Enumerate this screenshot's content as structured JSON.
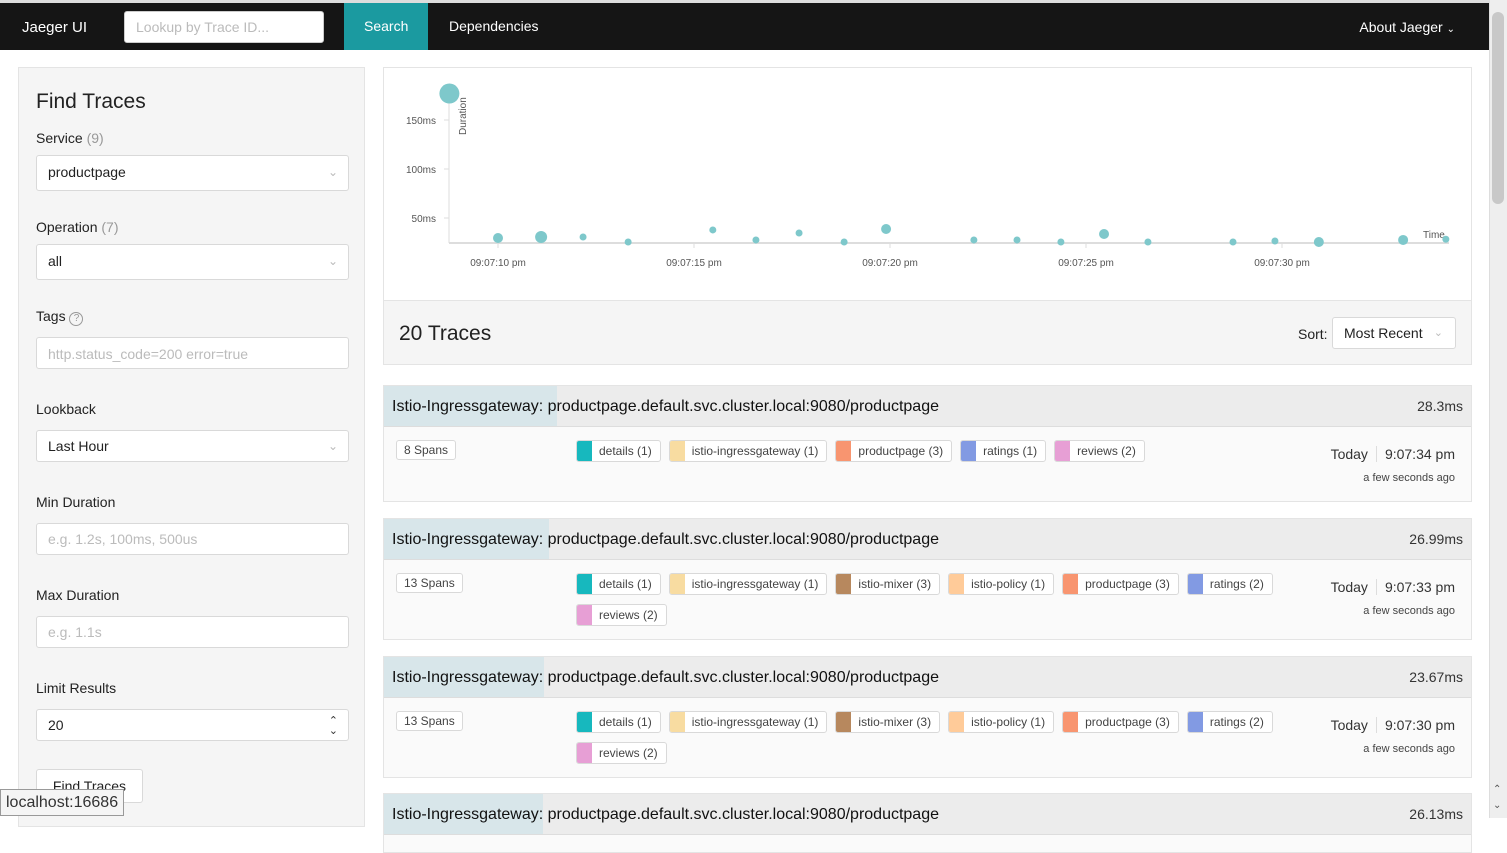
{
  "nav": {
    "brand": "Jaeger UI",
    "lookup_placeholder": "Lookup by Trace ID...",
    "search": "Search",
    "dependencies": "Dependencies",
    "about": "About Jaeger"
  },
  "form": {
    "title": "Find Traces",
    "service_label": "Service",
    "service_count": "(9)",
    "service_value": "productpage",
    "operation_label": "Operation",
    "operation_count": "(7)",
    "operation_value": "all",
    "tags_label": "Tags",
    "tags_placeholder": "http.status_code=200 error=true",
    "lookback_label": "Lookback",
    "lookback_value": "Last Hour",
    "min_label": "Min Duration",
    "min_placeholder": "e.g. 1.2s, 100ms, 500us",
    "max_label": "Max Duration",
    "max_placeholder": "e.g. 1.1s",
    "limit_label": "Limit Results",
    "limit_value": "20",
    "find_button": "Find Traces"
  },
  "status_url": "localhost:16686",
  "chart_data": {
    "type": "scatter",
    "ylabel": "Duration",
    "xlabel": "Time",
    "y_ticks": [
      "50ms",
      "100ms",
      "150ms"
    ],
    "y_tick_values": [
      50,
      100,
      150
    ],
    "x_ticks": [
      "09:07:10 pm",
      "09:07:15 pm",
      "09:07:20 pm",
      "09:07:25 pm",
      "09:07:30 pm"
    ],
    "x_tick_values": [
      10,
      15,
      20,
      25,
      30
    ],
    "xlim": [
      8.5,
      34.5
    ],
    "ylim": [
      25,
      180
    ],
    "color": "#7ec8cb",
    "points": [
      {
        "t": 8.76,
        "ms": 177,
        "spans": 30
      },
      {
        "t": 10.0,
        "ms": 29.6,
        "spans": 13
      },
      {
        "t": 11.1,
        "ms": 30.6,
        "spans": 16
      },
      {
        "t": 12.17,
        "ms": 30.6,
        "spans": 8
      },
      {
        "t": 13.32,
        "ms": 25,
        "spans": 8
      },
      {
        "t": 15.48,
        "ms": 37.8,
        "spans": 8
      },
      {
        "t": 16.58,
        "ms": 27.6,
        "spans": 8
      },
      {
        "t": 17.68,
        "ms": 34.7,
        "spans": 8
      },
      {
        "t": 18.83,
        "ms": 25,
        "spans": 8
      },
      {
        "t": 19.9,
        "ms": 38.8,
        "spans": 13
      },
      {
        "t": 22.14,
        "ms": 27.6,
        "spans": 8
      },
      {
        "t": 23.24,
        "ms": 27.6,
        "spans": 8
      },
      {
        "t": 24.36,
        "ms": 25.5,
        "spans": 8
      },
      {
        "t": 25.46,
        "ms": 33.7,
        "spans": 13
      },
      {
        "t": 26.58,
        "ms": 25,
        "spans": 8
      },
      {
        "t": 28.75,
        "ms": 25.5,
        "spans": 8
      },
      {
        "t": 29.82,
        "ms": 26.5,
        "spans": 8
      },
      {
        "t": 30.94,
        "ms": 25,
        "spans": 13
      },
      {
        "t": 33.09,
        "ms": 27.6,
        "spans": 13
      },
      {
        "t": 34.18,
        "ms": 28.3,
        "spans": 8
      }
    ]
  },
  "results": {
    "title": "20 Traces",
    "sort_label": "Sort:",
    "sort_value": "Most Recent"
  },
  "colors": {
    "details": "#17b8be",
    "istio-ingressgateway": "#f8dca1",
    "istio-mixer": "#b7885e",
    "istio-policy": "#ffcb99",
    "productpage": "#f89570",
    "ratings": "#829ae3",
    "reviews": "#e79fd5"
  },
  "traces": [
    {
      "name": "Istio-Ingressgateway: productpage.default.svc.cluster.local:9080/productpage",
      "duration": "28.3ms",
      "spans": "8 Spans",
      "day": "Today",
      "time": "9:07:34 pm",
      "ago": "a few seconds ago",
      "services": [
        {
          "k": "details",
          "label": "details (1)"
        },
        {
          "k": "istio-ingressgateway",
          "label": "istio-ingressgateway (1)"
        },
        {
          "k": "productpage",
          "label": "productpage (3)"
        },
        {
          "k": "ratings",
          "label": "ratings (1)"
        },
        {
          "k": "reviews",
          "label": "reviews (2)"
        }
      ]
    },
    {
      "name": "Istio-Ingressgateway: productpage.default.svc.cluster.local:9080/productpage",
      "duration": "26.99ms",
      "spans": "13 Spans",
      "day": "Today",
      "time": "9:07:33 pm",
      "ago": "a few seconds ago",
      "services": [
        {
          "k": "details",
          "label": "details (1)"
        },
        {
          "k": "istio-ingressgateway",
          "label": "istio-ingressgateway (1)"
        },
        {
          "k": "istio-mixer",
          "label": "istio-mixer (3)"
        },
        {
          "k": "istio-policy",
          "label": "istio-policy (1)"
        },
        {
          "k": "productpage",
          "label": "productpage (3)"
        },
        {
          "k": "ratings",
          "label": "ratings (2)"
        },
        {
          "k": "reviews",
          "label": "reviews (2)"
        }
      ]
    },
    {
      "name": "Istio-Ingressgateway: productpage.default.svc.cluster.local:9080/productpage",
      "duration": "23.67ms",
      "spans": "13 Spans",
      "day": "Today",
      "time": "9:07:30 pm",
      "ago": "a few seconds ago",
      "services": [
        {
          "k": "details",
          "label": "details (1)"
        },
        {
          "k": "istio-ingressgateway",
          "label": "istio-ingressgateway (1)"
        },
        {
          "k": "istio-mixer",
          "label": "istio-mixer (3)"
        },
        {
          "k": "istio-policy",
          "label": "istio-policy (1)"
        },
        {
          "k": "productpage",
          "label": "productpage (3)"
        },
        {
          "k": "ratings",
          "label": "ratings (2)"
        },
        {
          "k": "reviews",
          "label": "reviews (2)"
        }
      ]
    },
    {
      "name": "Istio-Ingressgateway: productpage.default.svc.cluster.local:9080/productpage",
      "duration": "26.13ms"
    }
  ]
}
